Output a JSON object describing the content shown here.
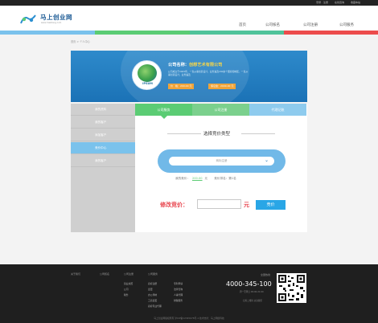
{
  "topbar": {
    "links": [
      "登录 · 注册",
      "在线咨询",
      "收藏本站"
    ]
  },
  "logo": {
    "title": "马上创业网",
    "url": "www.mashang.com"
  },
  "nav": {
    "items": [
      "首页",
      "公司核名",
      "公司注册",
      "公司服务"
    ]
  },
  "colors": {
    "blue": "#7ac2ec",
    "green": "#5bcc74",
    "red": "#ec4c4c",
    "banner": "#1b72b6",
    "button": "#29a6e6",
    "accent": "#e8444d"
  },
  "breadcrumb": "首页 > 个人中心",
  "company": {
    "name_label": "公司名称：",
    "name": "创想艺术有限公司",
    "desc": "公司成立于2005年，一直从事创意设计，业务遍及200余个国家和地区，一直从事创意设计，业务遍及",
    "avatar_text": "IPSUM",
    "price_tags": [
      "价　格：200.00 元",
      "保证金：2000.00 元"
    ]
  },
  "sidebar": {
    "items": [
      {
        "label": "我的资料"
      },
      {
        "label": "我的客户"
      },
      {
        "label": "添加客户"
      },
      {
        "label": "竞价中心"
      },
      {
        "label": "我的客户"
      }
    ]
  },
  "tabs": [
    {
      "label": "公司服务"
    },
    {
      "label": "公司注册"
    },
    {
      "label": "代理记账"
    }
  ],
  "bid": {
    "section_title": "选择竞价类型",
    "select_value": "商标注册",
    "my_bid_label": "我的竞价：",
    "my_bid_value": "200.00",
    "my_bid_unit": "元",
    "rank_label": "竞价排名：",
    "rank_value": "第1名",
    "modify_label": "修改竞价：",
    "modify_unit": "元",
    "button_label": "竞价"
  },
  "footer": {
    "cols": [
      "关于我们",
      "公司核名",
      "公司注册",
      "公司服务"
    ],
    "links": {
      "reg": [
        "营业执照",
        "公司",
        "税务"
      ],
      "service": [
        "商标注册",
        "变更",
        "办公场地",
        "工商变更",
        "商标专业代理"
      ],
      "service2": [
        "专利申请",
        "法律咨询",
        "人事代理",
        "财税服务"
      ]
    },
    "hotline_title": "全国热线",
    "phone": "4000-345-100",
    "hours": "周一至周日 09:00-21:00",
    "qr_note": "扫码二维码 关注我们",
    "copyright": "马上创业网版权所有 沪ICP备12345678号-1 技术支持：马上网络科技"
  }
}
